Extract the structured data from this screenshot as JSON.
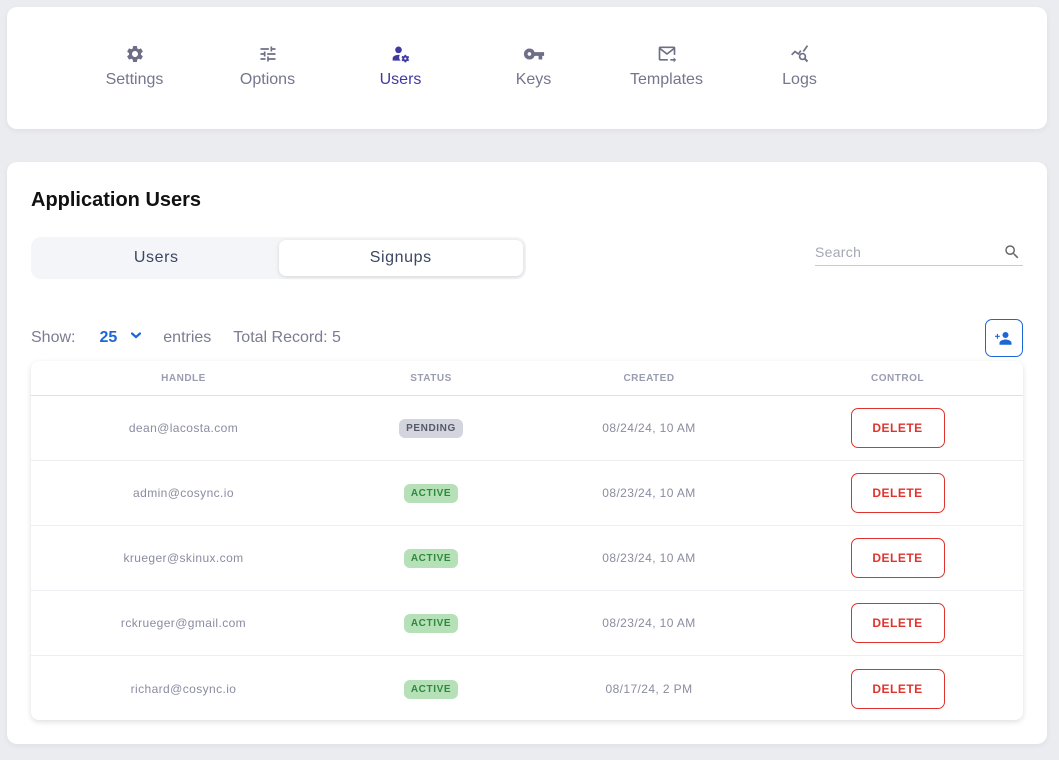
{
  "nav": {
    "items": [
      {
        "label": "Settings",
        "icon": "gear-icon",
        "active": false
      },
      {
        "label": "Options",
        "icon": "sliders-icon",
        "active": false
      },
      {
        "label": "Users",
        "icon": "user-gear-icon",
        "active": true
      },
      {
        "label": "Keys",
        "icon": "key-icon",
        "active": false
      },
      {
        "label": "Templates",
        "icon": "mail-forward-icon",
        "active": false
      },
      {
        "label": "Logs",
        "icon": "chart-search-icon",
        "active": false
      }
    ]
  },
  "main": {
    "title": "Application Users",
    "tabs": [
      {
        "label": "Users",
        "active": false
      },
      {
        "label": "Signups",
        "active": true
      }
    ],
    "search": {
      "placeholder": "Search",
      "value": ""
    },
    "show": {
      "label": "Show:",
      "value": "25",
      "entries_label": "entries",
      "total_label": "Total Record: 5"
    },
    "add_user_icon": "add-user-icon",
    "table": {
      "columns": [
        "HANDLE",
        "STATUS",
        "CREATED",
        "CONTROL"
      ],
      "rows": [
        {
          "handle": "dean@lacosta.com",
          "status": "PENDING",
          "status_type": "pending",
          "created": "08/24/24, 10 AM",
          "action": "DELETE"
        },
        {
          "handle": "admin@cosync.io",
          "status": "ACTIVE",
          "status_type": "active",
          "created": "08/23/24, 10 AM",
          "action": "DELETE"
        },
        {
          "handle": "krueger@skinux.com",
          "status": "ACTIVE",
          "status_type": "active",
          "created": "08/23/24, 10 AM",
          "action": "DELETE"
        },
        {
          "handle": "rckrueger@gmail.com",
          "status": "ACTIVE",
          "status_type": "active",
          "created": "08/23/24, 10 AM",
          "action": "DELETE"
        },
        {
          "handle": "richard@cosync.io",
          "status": "ACTIVE",
          "status_type": "active",
          "created": "08/17/24, 2 PM",
          "action": "DELETE"
        }
      ]
    }
  },
  "colors": {
    "accent": "#1c67d6",
    "nav_active": "#3f3aa2",
    "danger": "#e0332d",
    "active_badge_bg": "#b6e0b8",
    "pending_badge_bg": "#d3d5de"
  }
}
